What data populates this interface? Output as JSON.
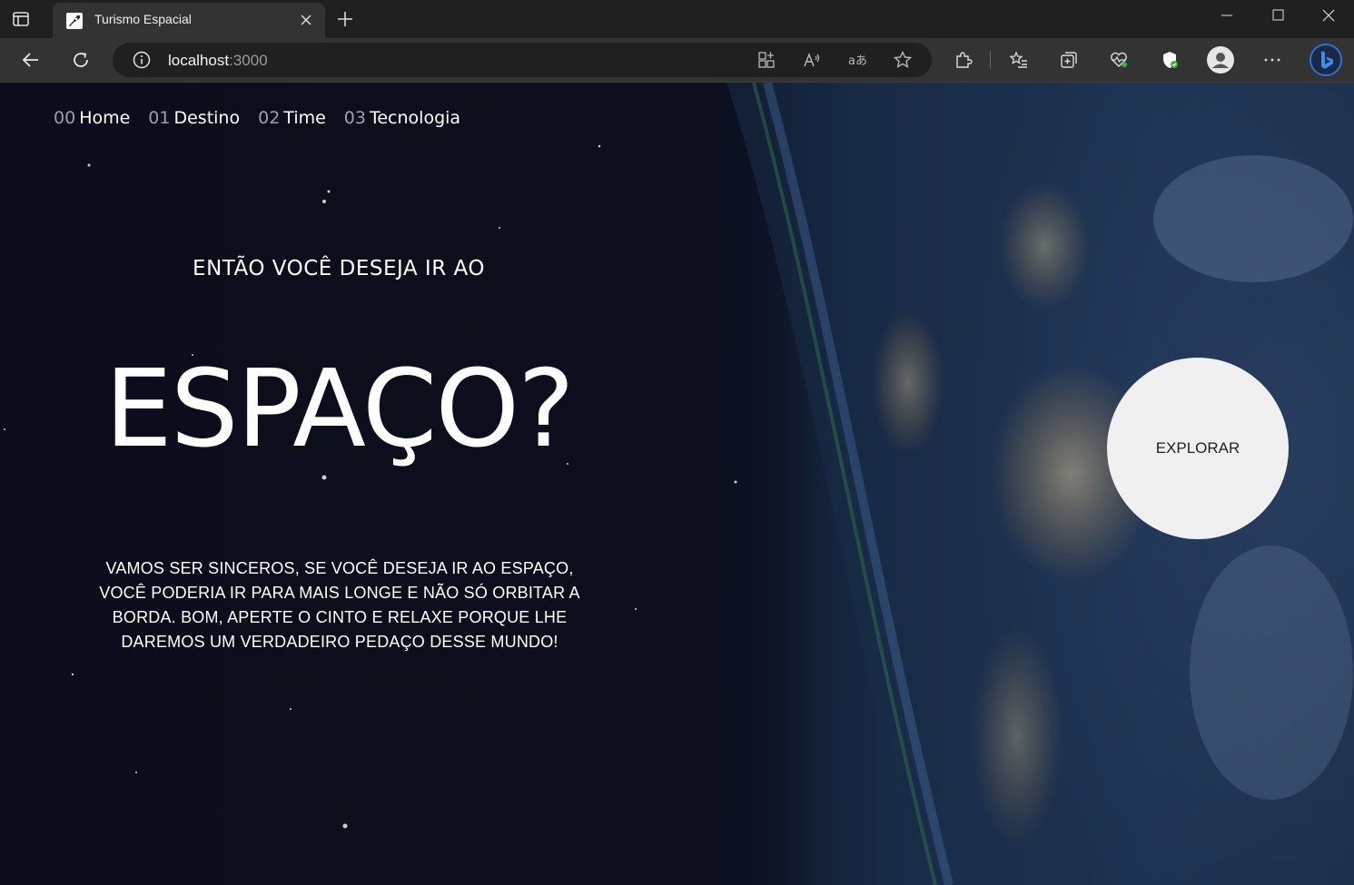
{
  "browser": {
    "tab_title": "Turismo Espacial",
    "url_host": "localhost",
    "url_port": ":3000"
  },
  "nav": {
    "items": [
      {
        "num": "00",
        "label": "Home"
      },
      {
        "num": "01",
        "label": "Destino"
      },
      {
        "num": "02",
        "label": "Time"
      },
      {
        "num": "03",
        "label": "Tecnologia"
      }
    ]
  },
  "hero": {
    "subtitle": "ENTÃO VOCÊ DESEJA IR AO",
    "headline": "ESPAÇO?",
    "body": "VAMOS SER SINCEROS, SE VOCÊ DESEJA IR AO ESPAÇO, VOCÊ PODERIA IR PARA MAIS LONGE E NÃO SÓ ORBITAR A BORDA. BOM, APERTE O CINTO E RELAXE PORQUE LHE DAREMOS UM VERDADEIRO PEDAÇO DESSE MUNDO!",
    "cta": "EXPLORAR"
  },
  "colors": {
    "background": "#0b0d1c",
    "browser_frame": "#202020",
    "toolbar": "#333333",
    "cta_bg": "#f0f0f0",
    "nav_number": "#9aa0ad"
  }
}
